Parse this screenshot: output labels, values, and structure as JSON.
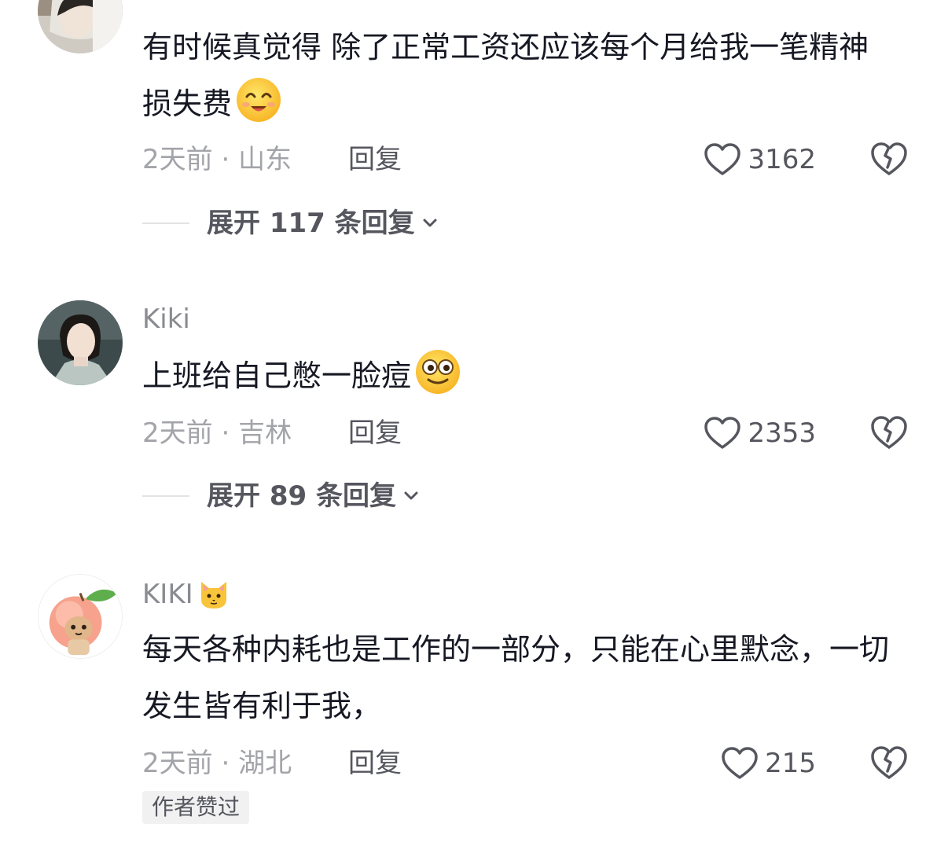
{
  "comments": [
    {
      "username": "",
      "text": "有时候真觉得 除了正常工资还应该每个月给我一笔精神损失费",
      "emoji": "smiling-face-emoji",
      "time": "2天前",
      "location": "山东",
      "reply_label": "回复",
      "likes": "3162",
      "expand_label": "展开 117 条回复"
    },
    {
      "username": "Kiki",
      "text": "上班给自己憋一脸痘",
      "emoji": "dizzy-eyes-emoji",
      "time": "2天前",
      "location": "吉林",
      "reply_label": "回复",
      "likes": "2353",
      "expand_label": "展开 89 条回复"
    },
    {
      "username": "KIKI",
      "username_emoji": "cat-face-emoji",
      "text": "每天各种内耗也是工作的一部分，只能在心里默念，一切发生皆有利于我，",
      "time": "2天前",
      "location": "湖北",
      "reply_label": "回复",
      "likes": "215",
      "badge": "作者赞过"
    }
  ],
  "separator": " · ",
  "icons": {
    "like": "heart-outline-icon",
    "dislike": "broken-heart-icon",
    "expand": "chevron-down-icon"
  },
  "colors": {
    "primary_text": "#161823",
    "secondary_text": "#a3a4a9",
    "action_text": "#55565e",
    "badge_bg": "#f1f1f2"
  }
}
